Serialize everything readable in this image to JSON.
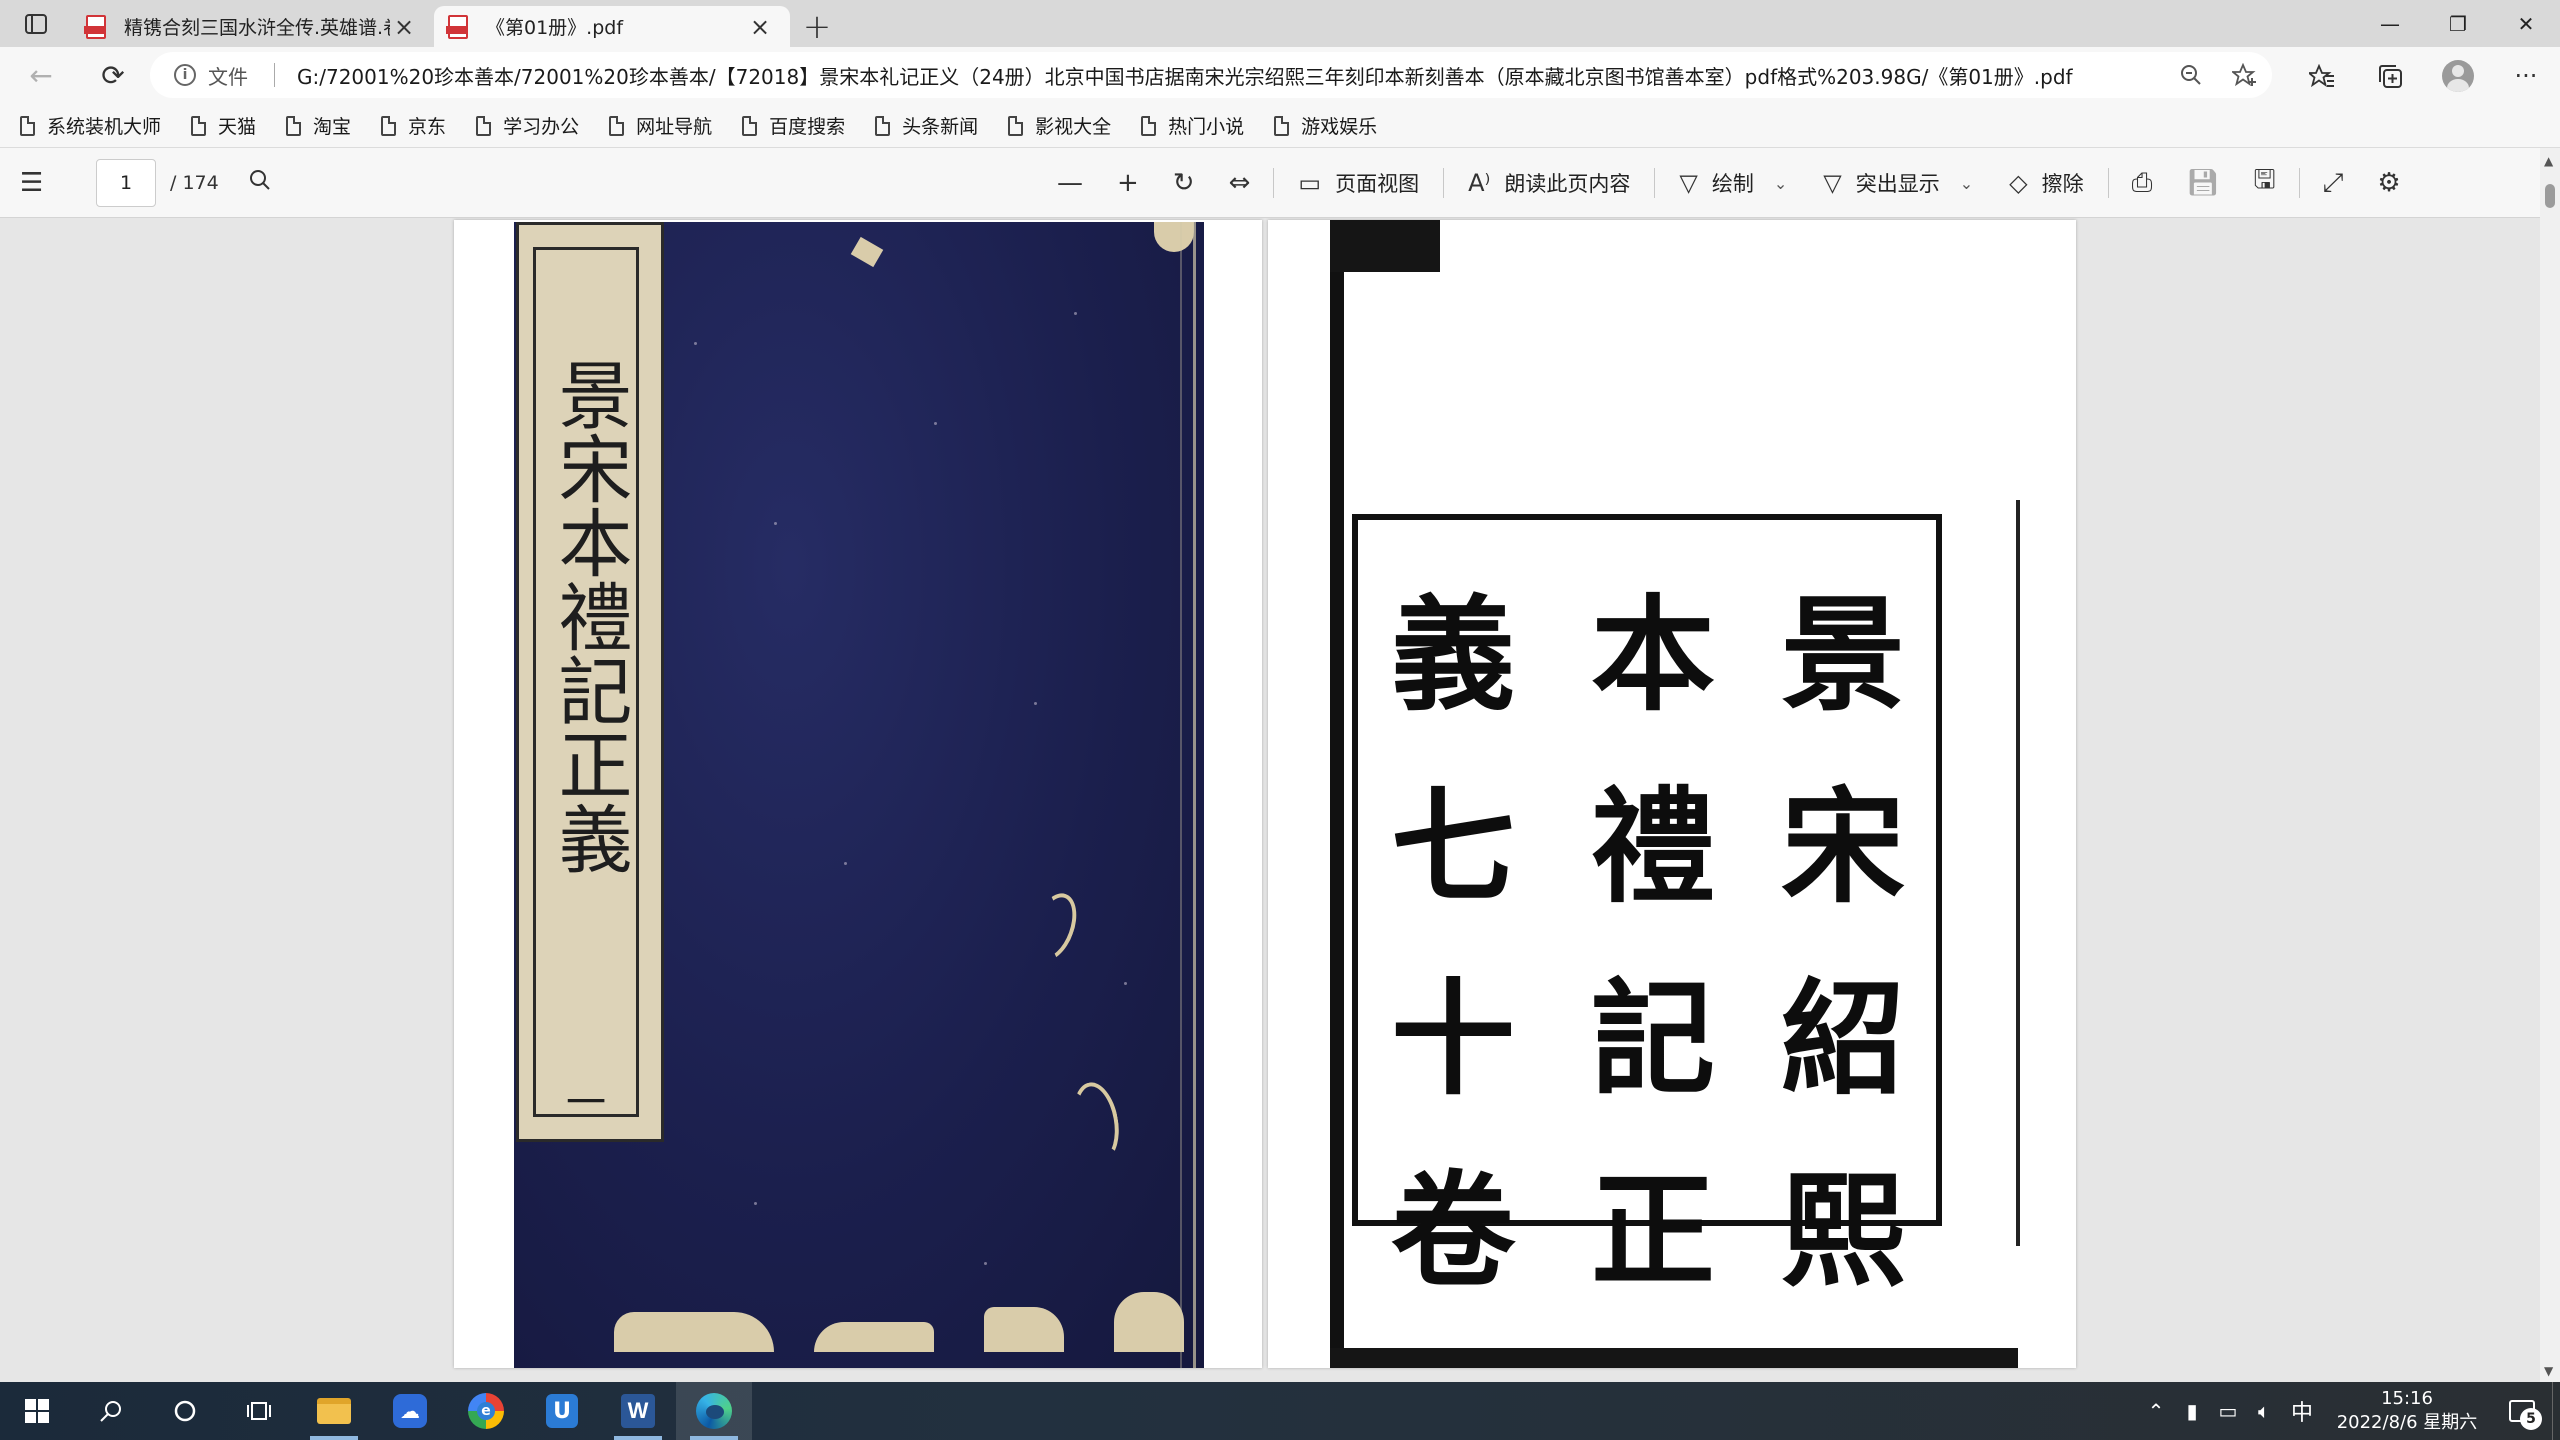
{
  "tabs": [
    {
      "title": "精镌合刻三国水浒全传.英雄谱.卷",
      "active": false
    },
    {
      "title": "《第01册》.pdf",
      "active": true
    }
  ],
  "address": {
    "site_label": "文件",
    "url": "G:/72001%20珍本善本/72001%20珍本善本/【72018】景宋本礼记正义（24册）北京中国书店据南宋光宗绍熙三年刻印本新刻善本（原本藏北京图书馆善本室）pdf格式%203.98G/《第01册》.pdf"
  },
  "favorites": [
    "系统装机大师",
    "天猫",
    "淘宝",
    "京东",
    "学习办公",
    "网址导航",
    "百度搜索",
    "头条新闻",
    "影视大全",
    "热门小说",
    "游戏娱乐"
  ],
  "pdf_toolbar": {
    "page_current": "1",
    "page_total": "/ 174",
    "page_view_label": "页面视图",
    "read_aloud_label": "朗读此页内容",
    "draw_label": "绘制",
    "highlight_label": "突出显示",
    "erase_label": "擦除"
  },
  "document": {
    "cover_label": "景宋本禮記正義",
    "cover_volume": "一",
    "title_columns": [
      "景宋紹熙",
      "本禮記正",
      "義七十卷"
    ]
  },
  "taskbar": {
    "ime": "中",
    "time": "15:16",
    "date": "2022/8/6 星期六",
    "notification_count": "5"
  },
  "colors": {
    "tab_active_bg": "#f7f7f7",
    "tabstrip_bg": "#d9d9d9",
    "pdf_icon_red": "#d13438",
    "cover_blue": "#1b1f4d",
    "taskbar_bg": "#1b2a3a"
  }
}
